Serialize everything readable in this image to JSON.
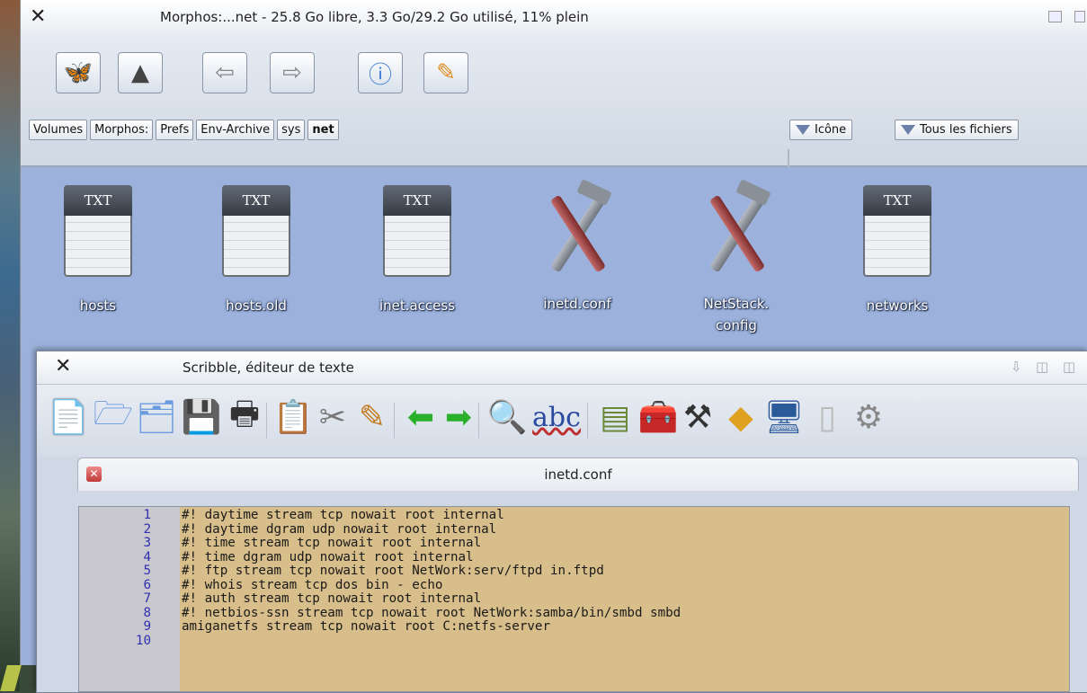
{
  "desktop": {},
  "file_manager": {
    "title": "Morphos:...net - 25.8 Go libre, 3.3 Go/29.2 Go utilisé, 11% plein",
    "toolbar_icons": [
      "volumes-icon",
      "parent-icon",
      "back-icon",
      "forward-icon",
      "info-icon",
      "edit-icon"
    ],
    "breadcrumbs": [
      "Volumes",
      "Morphos:",
      "Prefs",
      "Env-Archive",
      "sys",
      "net"
    ],
    "view_mode": "Icône",
    "filter": "Tous les fichiers",
    "files": [
      {
        "name": "hosts",
        "icon": "text-file-icon",
        "badge": "TXT"
      },
      {
        "name": "hosts.old",
        "icon": "text-file-icon",
        "badge": "TXT"
      },
      {
        "name": "inet.access",
        "icon": "text-file-icon",
        "badge": "TXT"
      },
      {
        "name": "inetd.conf",
        "icon": "tools-icon"
      },
      {
        "name": "NetStack.",
        "name2": "config",
        "icon": "tools-icon"
      },
      {
        "name": "networks",
        "icon": "text-file-icon",
        "badge": "TXT"
      }
    ]
  },
  "editor": {
    "title": "Scribble, éditeur de texte",
    "toolbar_icons": [
      "new-file-icon",
      "open-icon",
      "open-new-icon",
      "save-icon",
      "print-icon",
      "paste-icon",
      "cut-icon",
      "glue-icon",
      "undo-icon",
      "redo-icon",
      "search-icon",
      "spellcheck-icon",
      "macro-icon",
      "tools-icon",
      "hammer-icon",
      "warning-icon",
      "display-icon",
      "document-icon",
      "settings-gear-icon"
    ],
    "spellcheck_label": "abc",
    "tab_title": "inetd.conf",
    "lines": [
      {
        "n": "1",
        "text": "#! daytime stream tcp nowait root internal"
      },
      {
        "n": "2",
        "text": "#! daytime dgram udp nowait root internal"
      },
      {
        "n": "3",
        "text": "#! time stream tcp nowait root internal"
      },
      {
        "n": "4",
        "text": "#! time dgram udp nowait root internal"
      },
      {
        "n": "5",
        "text": "#! ftp stream tcp nowait root NetWork:serv/ftpd in.ftpd"
      },
      {
        "n": "6",
        "text": "#! whois stream tcp dos bin - echo"
      },
      {
        "n": "7",
        "text": "#! auth stream tcp nowait root internal"
      },
      {
        "n": "8",
        "text": "#! netbios-ssn stream tcp nowait root NetWork:samba/bin/smbd smbd"
      },
      {
        "n": "9",
        "text": "amiganetfs stream tcp nowait root C:netfs-server"
      },
      {
        "n": "10",
        "text": ""
      }
    ]
  }
}
